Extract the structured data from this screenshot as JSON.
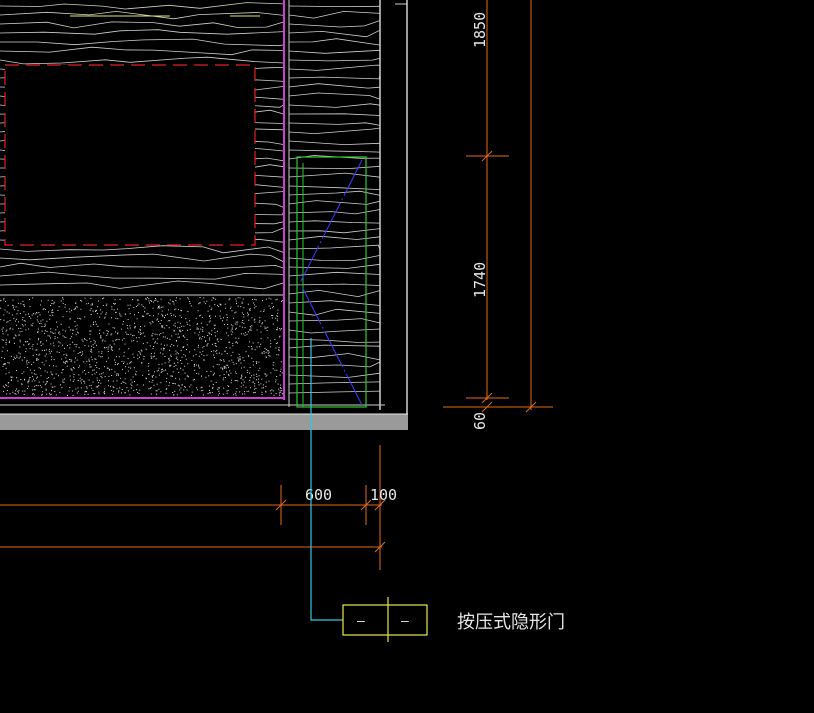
{
  "drawing": {
    "dimensions": {
      "vertical": [
        "1850",
        "1740",
        "60"
      ],
      "horizontal": [
        "600",
        "100"
      ]
    },
    "leader": {
      "label": "按压式隐形门",
      "tag_left": "–",
      "tag_right": "–"
    },
    "colors": {
      "background": "#000000",
      "wood_lines": "#cfcfcf",
      "pink_line": "#d23cd2",
      "red_dashed": "#e02020",
      "green_frame": "#2ec82e",
      "blue_line": "#3a3aff",
      "cyan_leader": "#2ec8e0",
      "dimension": "#e06a1a",
      "tag_box": "#e8e84a",
      "floor_slab": "#9a9a9a"
    }
  }
}
